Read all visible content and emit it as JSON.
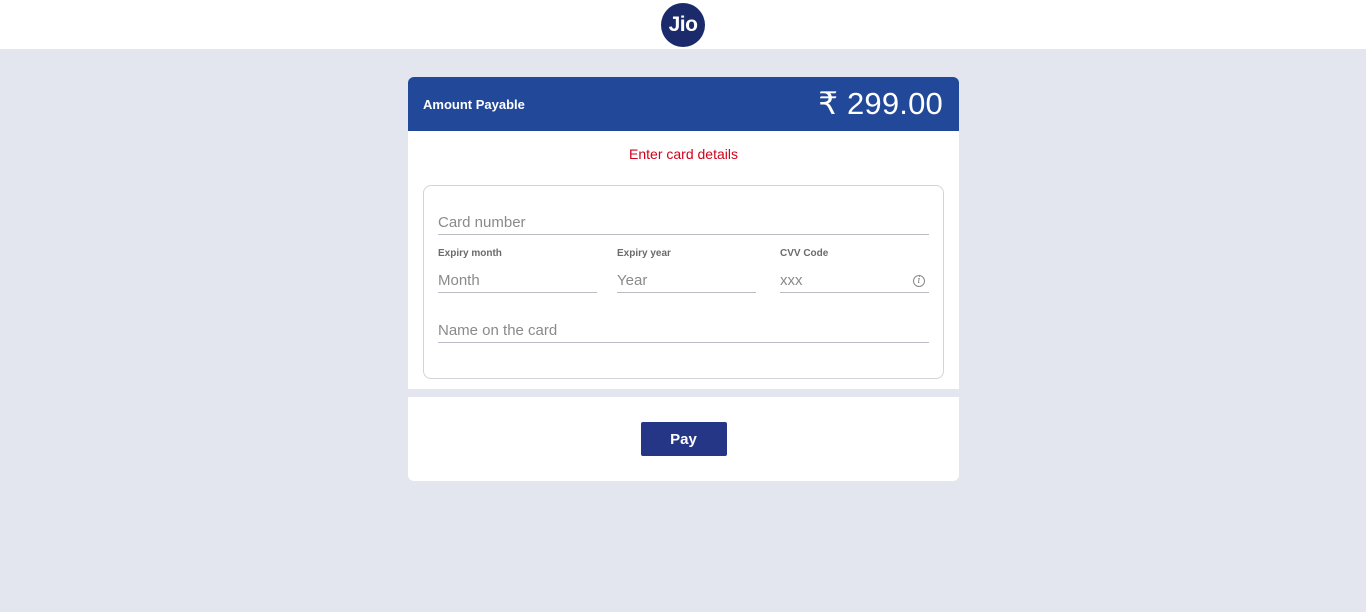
{
  "header": {
    "logo_text": "Jio"
  },
  "payment": {
    "amount_label": "Amount Payable",
    "amount_value": "₹ 299.00",
    "instruction": "Enter card details"
  },
  "form": {
    "card_number_placeholder": "Card number",
    "expiry_month_label": "Expiry month",
    "expiry_month_placeholder": "Month",
    "expiry_year_label": "Expiry year",
    "expiry_year_placeholder": "Year",
    "cvv_label": "CVV Code",
    "cvv_placeholder": "xxx",
    "cvv_info_icon": "i",
    "name_placeholder": "Name on the card"
  },
  "actions": {
    "pay_label": "Pay"
  },
  "colors": {
    "brand_blue": "#224899",
    "button_blue": "#253687",
    "error_red": "#d0021b",
    "page_bg": "#e3e6ef"
  }
}
